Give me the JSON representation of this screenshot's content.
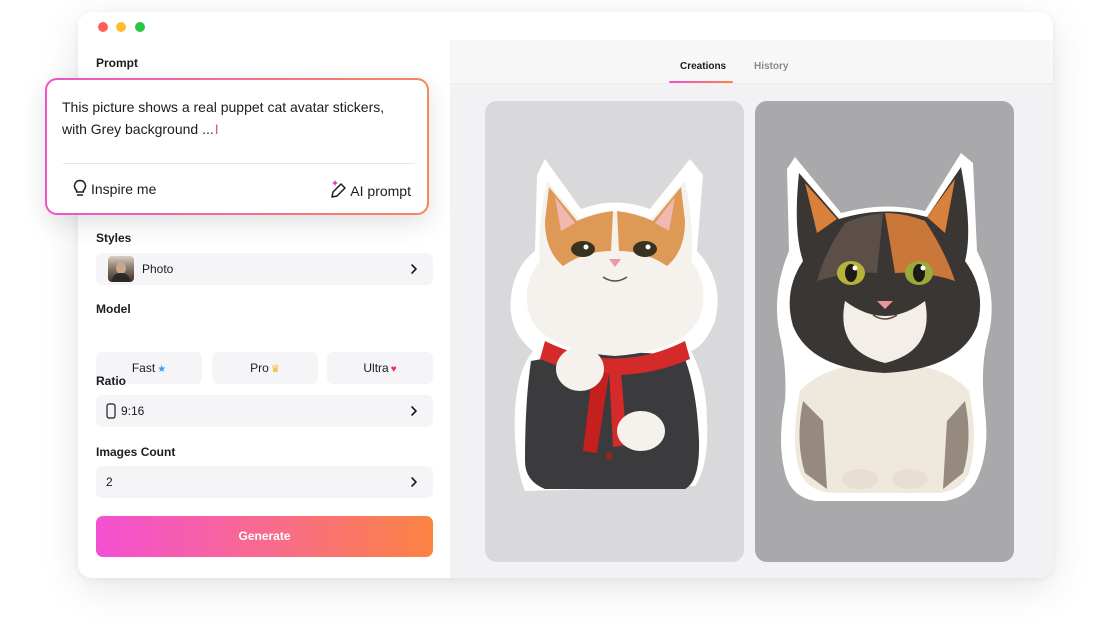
{
  "sidebar": {
    "prompt_label": "Prompt",
    "styles_label": "Styles",
    "style_value": "Photo",
    "model_label": "Model",
    "model_options": [
      {
        "label": "Fast",
        "icon": "star-icon",
        "color": "#3d9be9"
      },
      {
        "label": "Pro",
        "icon": "crown-icon",
        "color": "#f3b523"
      },
      {
        "label": "Ultra",
        "icon": "heart-icon",
        "color": "#e8306a"
      }
    ],
    "ratio_label": "Ratio",
    "ratio_value": "9:16",
    "images_count_label": "Images Count",
    "images_count_value": "2",
    "generate_label": "Generate"
  },
  "prompt": {
    "text": "This picture shows a real puppet cat avatar stickers, with Grey background ...",
    "inspire_label": "Inspire me",
    "ai_prompt_label": "AI prompt"
  },
  "main": {
    "tabs": [
      {
        "label": "Creations",
        "active": true
      },
      {
        "label": "History",
        "active": false
      }
    ]
  },
  "colors": {
    "accent_start": "#f44fd2",
    "accent_end": "#fb8341"
  }
}
